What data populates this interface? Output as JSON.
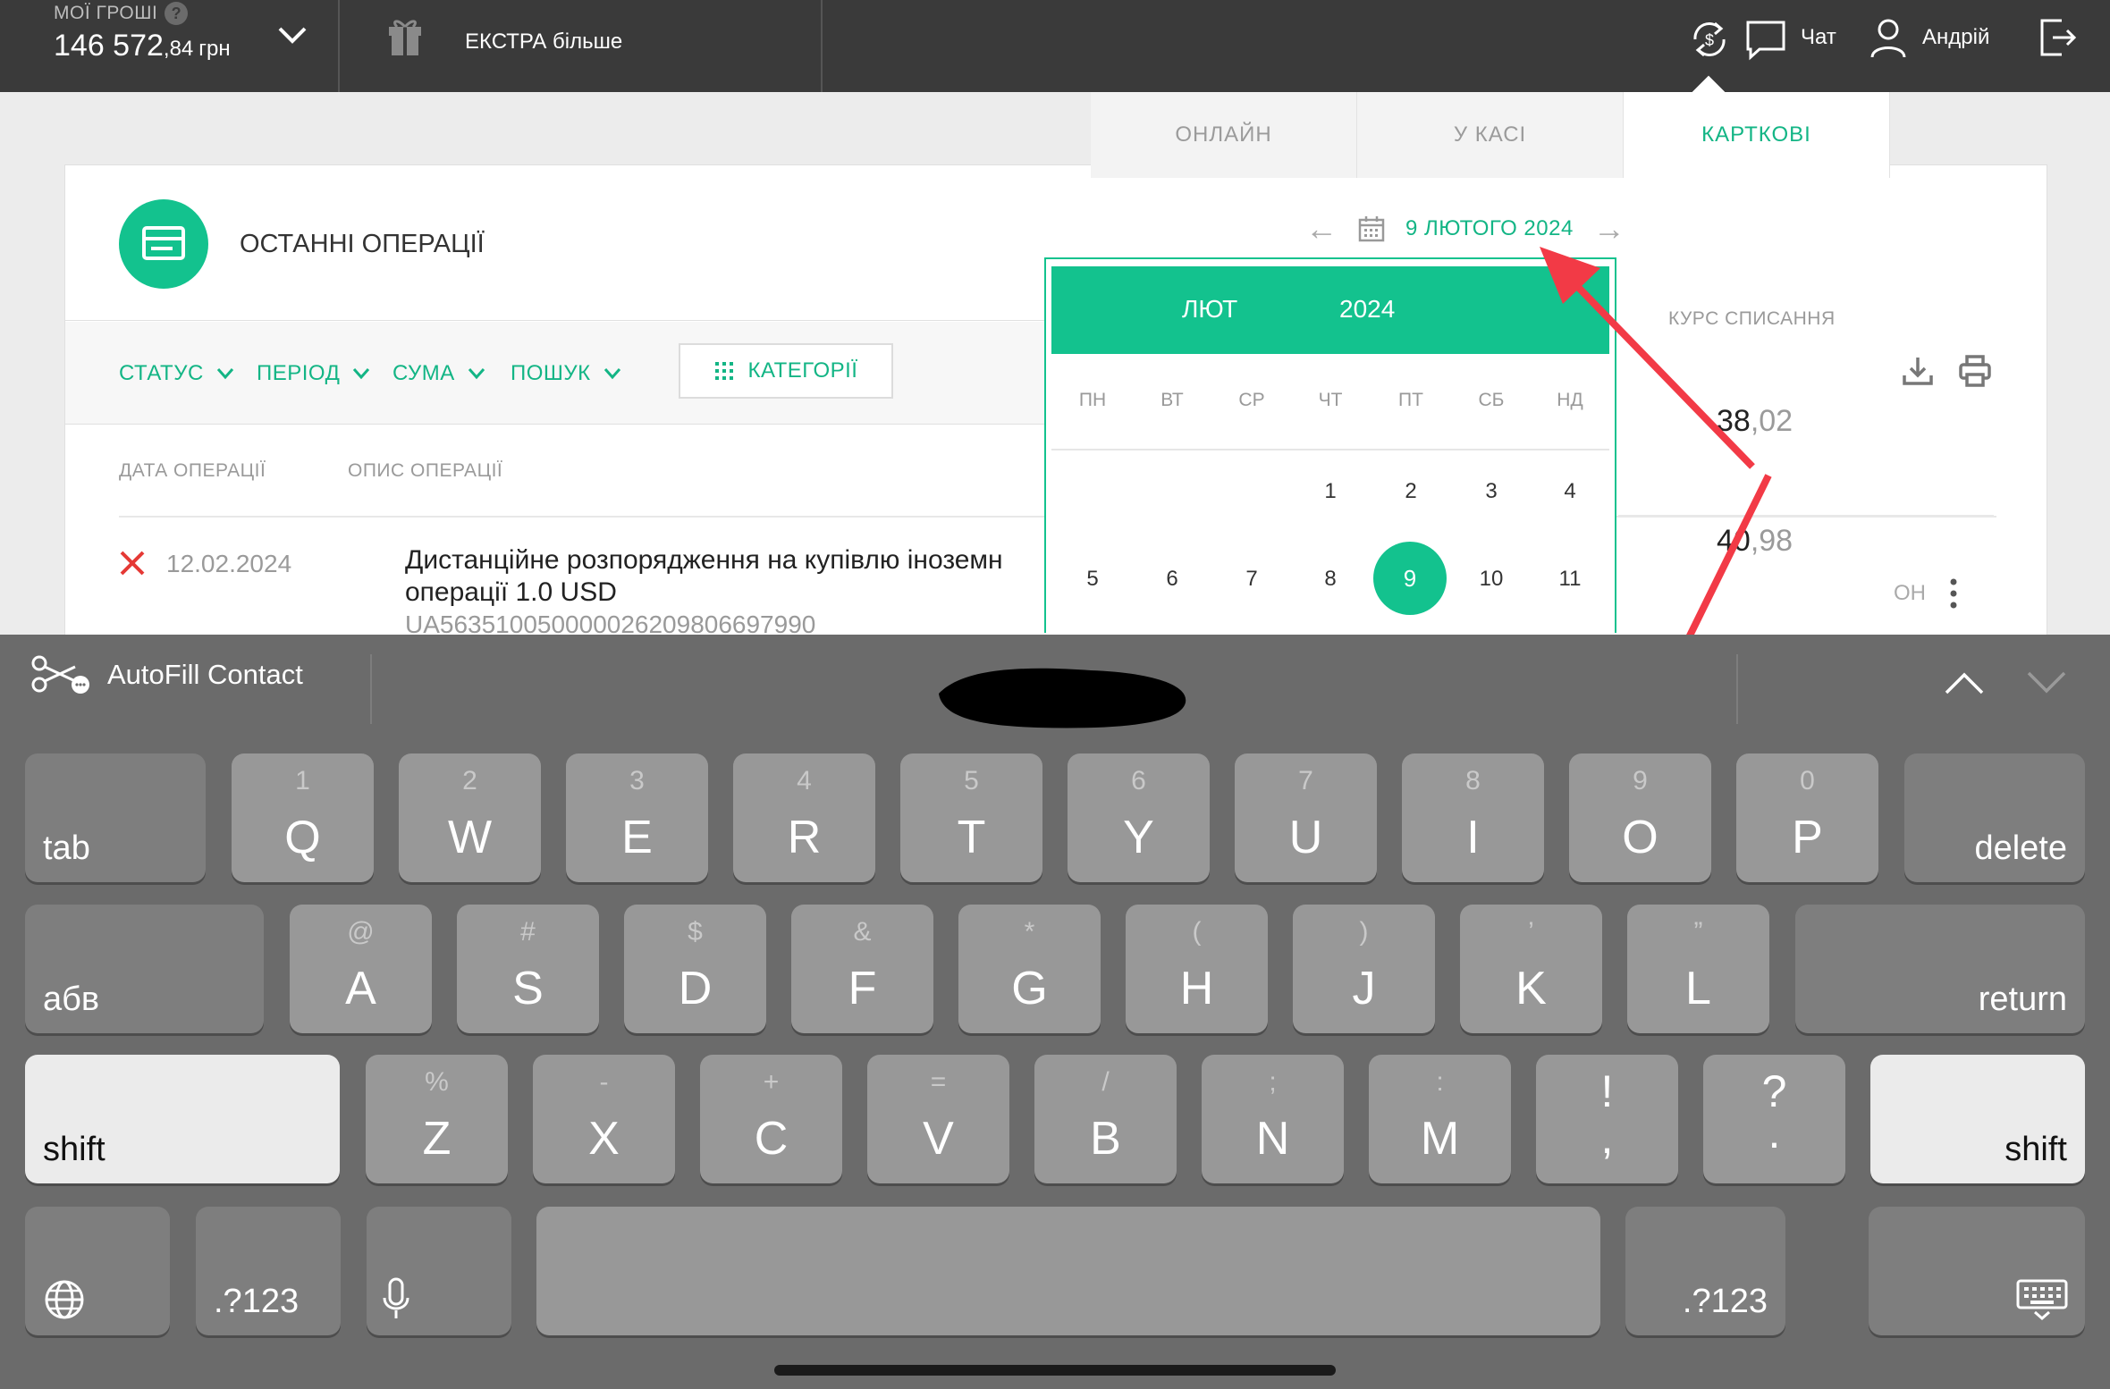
{
  "topbar": {
    "money_label": "МОЇ ГРОШІ",
    "help": "?",
    "money_main": "146 572",
    "money_cents": ",84",
    "money_currency": "грн",
    "extra_label": "ЕКСТРА більше",
    "chat_label": "Чат",
    "user_label": "Андрій"
  },
  "operations": {
    "title": "ОСТАННІ ОПЕРАЦІЇ",
    "filters": [
      "СТАТУС",
      "ПЕРІОД",
      "СУМА",
      "ПОШУК"
    ],
    "categories_button": "КАТЕГОРІЇ",
    "col_date": "ДАТА ОПЕРАЦІЇ",
    "col_desc": "ОПИС ОПЕРАЦІЇ",
    "row": {
      "date": "12.02.2024",
      "desc_line1": "Дистанційне розпорядження на купівлю іноземн",
      "desc_line2": "операції 1.0 USD",
      "iban": "UA563510050000026209806697990",
      "tail": "ОН"
    }
  },
  "rates": {
    "tabs": [
      "ОНЛАЙН",
      "У КАСІ",
      "КАРТКОВІ"
    ],
    "active_tab": "КАРТКОВІ",
    "date": "9 ЛЮТОГО 2024",
    "prev": "←",
    "next": "→",
    "kurs_label": "КУРС СПИСАННЯ",
    "rate1_int": "38",
    "rate1_dec": ",02",
    "rate2_int": "40",
    "rate2_dec": ",98"
  },
  "calendar": {
    "month": "ЛЮТ",
    "year": "2024",
    "weekdays": [
      "ПН",
      "ВТ",
      "СР",
      "ЧТ",
      "ПТ",
      "СБ",
      "НД"
    ],
    "week1": [
      "1",
      "2",
      "3",
      "4"
    ],
    "week2": [
      "5",
      "6",
      "7",
      "8",
      "9",
      "10",
      "11"
    ],
    "selected": "9"
  },
  "keyboard": {
    "autofill": "AutoFill Contact",
    "row1": [
      {
        "alt": "1",
        "key": "Q"
      },
      {
        "alt": "2",
        "key": "W"
      },
      {
        "alt": "3",
        "key": "E"
      },
      {
        "alt": "4",
        "key": "R"
      },
      {
        "alt": "5",
        "key": "T"
      },
      {
        "alt": "6",
        "key": "Y"
      },
      {
        "alt": "7",
        "key": "U"
      },
      {
        "alt": "8",
        "key": "I"
      },
      {
        "alt": "9",
        "key": "O"
      },
      {
        "alt": "0",
        "key": "P"
      }
    ],
    "row2": [
      {
        "alt": "@",
        "key": "A"
      },
      {
        "alt": "#",
        "key": "S"
      },
      {
        "alt": "$",
        "key": "D"
      },
      {
        "alt": "&",
        "key": "F"
      },
      {
        "alt": "*",
        "key": "G"
      },
      {
        "alt": "(",
        "key": "H"
      },
      {
        "alt": ")",
        "key": "J"
      },
      {
        "alt": "’",
        "key": "K"
      },
      {
        "alt": "”",
        "key": "L"
      }
    ],
    "row3": [
      {
        "alt": "%",
        "key": "Z"
      },
      {
        "alt": "-",
        "key": "X"
      },
      {
        "alt": "+",
        "key": "C"
      },
      {
        "alt": "=",
        "key": "V"
      },
      {
        "alt": "/",
        "key": "B"
      },
      {
        "alt": ";",
        "key": "N"
      },
      {
        "alt": ":",
        "key": "M"
      }
    ],
    "excl_top": "!",
    "excl_bottom": ",",
    "quest_top": "?",
    "quest_bottom": ".",
    "tab": "tab",
    "delete": "delete",
    "lang": "абв",
    "return": "return",
    "shift": "shift",
    "numbers": ".?123"
  },
  "colors": {
    "accent": "#13c28e",
    "topbar": "#3a3a3a",
    "arrow": "#f23a46",
    "keyboard": "#6b6b6b"
  }
}
